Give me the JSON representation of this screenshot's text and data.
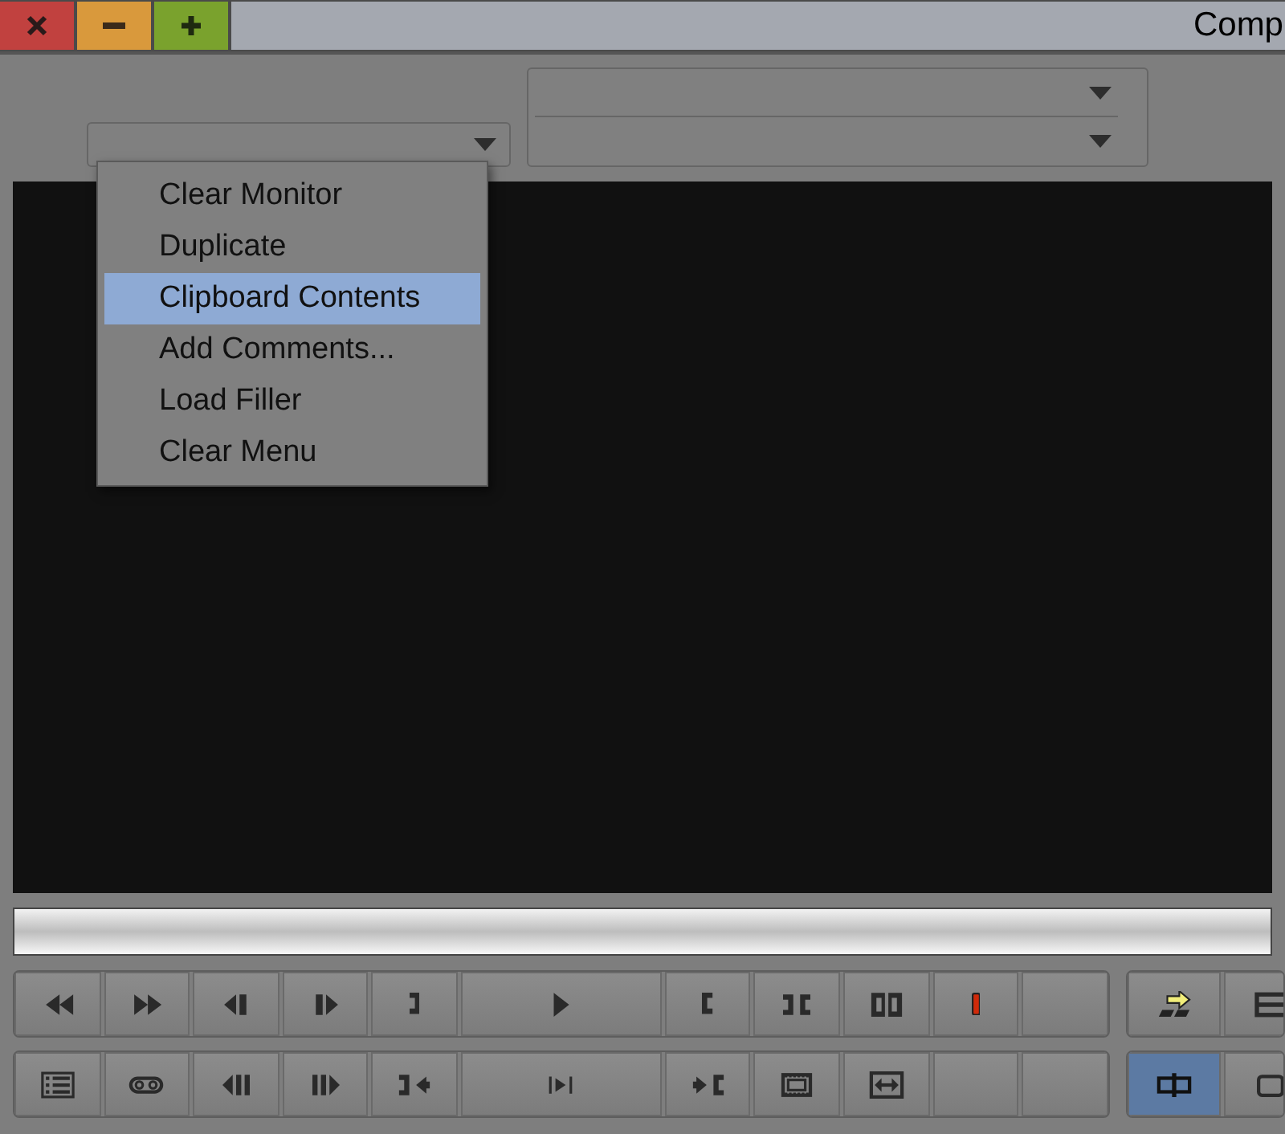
{
  "window": {
    "title": "Comp"
  },
  "source_menu": {
    "items": [
      {
        "label": "Clear Monitor",
        "selected": false
      },
      {
        "label": "Duplicate",
        "selected": false
      },
      {
        "label": "Clipboard Contents",
        "selected": true
      },
      {
        "label": "Add Comments...",
        "selected": false
      },
      {
        "label": "Load Filler",
        "selected": false
      },
      {
        "label": "Clear Menu",
        "selected": false
      }
    ]
  },
  "mode_buttons": [
    {
      "selected": false
    },
    {
      "selected": false
    },
    {
      "selected": true
    },
    {
      "selected": false
    }
  ]
}
